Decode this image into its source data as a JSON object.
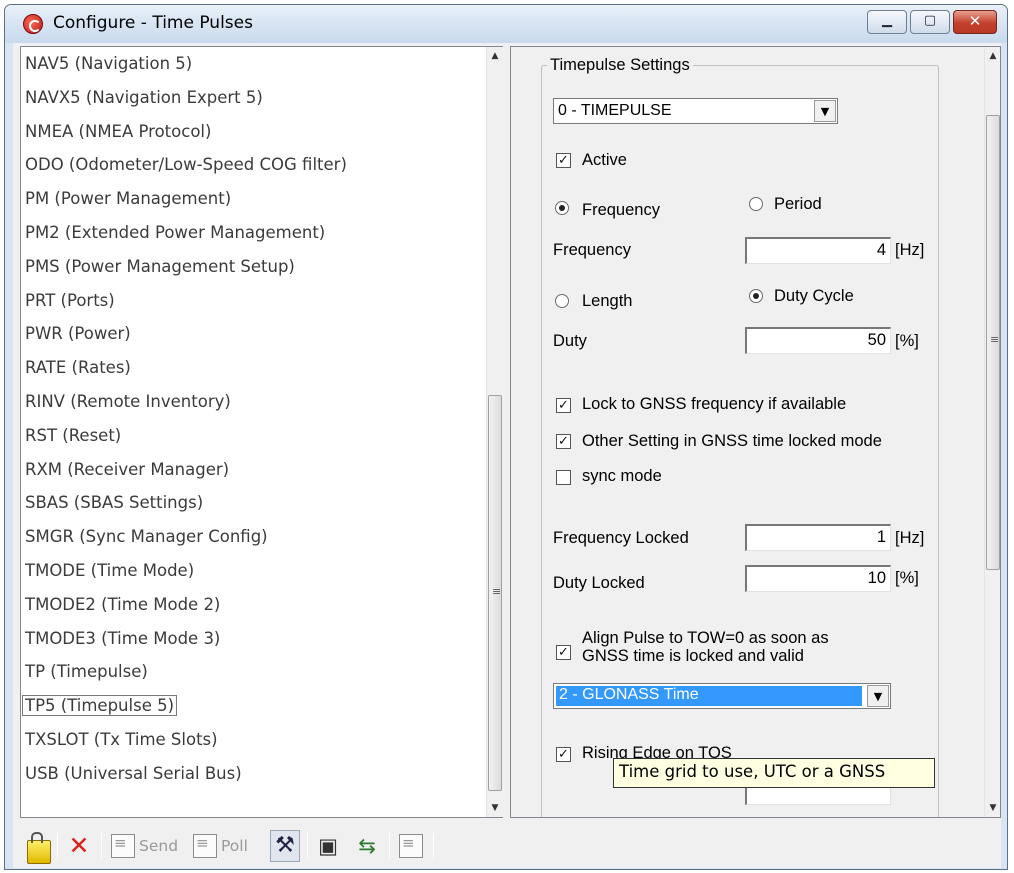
{
  "window": {
    "title": "Configure - Time Pulses",
    "minimize_glyph": "▁",
    "maximize_glyph": "▢",
    "close_glyph": "✕"
  },
  "message_list": {
    "items": [
      "NAV5 (Navigation 5)",
      "NAVX5 (Navigation Expert 5)",
      "NMEA (NMEA Protocol)",
      "ODO (Odometer/Low-Speed COG filter)",
      "PM (Power Management)",
      "PM2 (Extended Power Management)",
      "PMS (Power Management Setup)",
      "PRT (Ports)",
      "PWR (Power)",
      "RATE (Rates)",
      "RINV (Remote Inventory)",
      "RST (Reset)",
      "RXM (Receiver Manager)",
      "SBAS (SBAS Settings)",
      "SMGR (Sync Manager Config)",
      "TMODE (Time Mode)",
      "TMODE2 (Time Mode 2)",
      "TMODE3 (Time Mode 3)",
      "TP (Timepulse)",
      "TP5 (Timepulse 5)",
      "TXSLOT (Tx Time Slots)",
      "USB (Universal Serial Bus)"
    ],
    "selected_index": 19
  },
  "timepulse": {
    "group_title": "Timepulse Settings",
    "pulse_select": "0 - TIMEPULSE",
    "active_label": "Active",
    "active_checked": true,
    "frequency_radio_label": "Frequency",
    "period_radio_label": "Period",
    "frequency_selected": true,
    "frequency_label": "Frequency",
    "frequency_value": "4",
    "frequency_unit": "[Hz]",
    "length_radio_label": "Length",
    "duty_cycle_radio_label": "Duty Cycle",
    "duty_cycle_selected": true,
    "duty_label": "Duty",
    "duty_value": "50",
    "duty_unit": "[%]",
    "lock_gnss_label": "Lock to GNSS frequency if available",
    "lock_gnss_checked": true,
    "other_setting_label": "Other Setting in GNSS time locked mode",
    "other_setting_checked": true,
    "sync_mode_label": "sync mode",
    "sync_mode_checked": false,
    "freq_locked_label": "Frequency Locked",
    "freq_locked_value": "1",
    "freq_locked_unit": "[Hz]",
    "duty_locked_label": "Duty Locked",
    "duty_locked_value": "10",
    "duty_locked_unit": "[%]",
    "align_label_line1": "Align Pulse to TOW=0 as soon as",
    "align_label_line2": "GNSS time is locked and valid",
    "align_checked": true,
    "time_grid_select": "2 - GLONASS Time",
    "rising_edge_label": "Rising Edge on TOS",
    "rising_edge_checked": true
  },
  "tooltip": "Time grid to use, UTC or a GNSS",
  "toolbar": {
    "send_label": "Send",
    "poll_label": "Poll"
  },
  "colors": {
    "selection": "#3399ff",
    "tooltip_bg": "#ffffe1",
    "close_button": "#c2402b"
  }
}
